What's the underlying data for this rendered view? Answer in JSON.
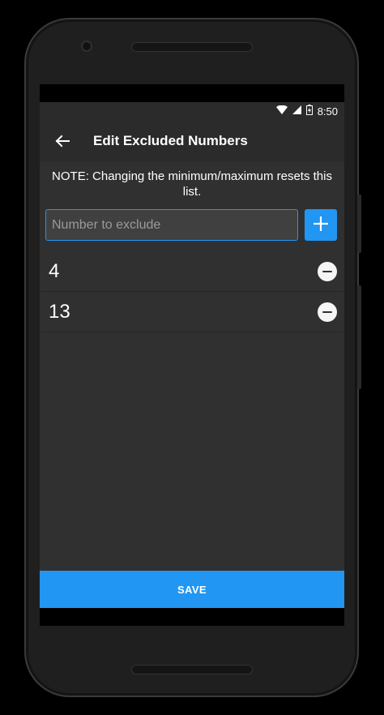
{
  "status_bar": {
    "time": "8:50",
    "icons": [
      "wifi-icon",
      "signal-icon",
      "battery-icon"
    ]
  },
  "app_bar": {
    "back_icon": "arrow-left-icon",
    "title": "Edit Excluded Numbers"
  },
  "note": "NOTE: Changing the minimum/maximum resets this list.",
  "exclude_input": {
    "value": "",
    "placeholder": "Number to exclude"
  },
  "add_button": {
    "icon": "plus-icon"
  },
  "excluded_numbers": [
    {
      "value": "4",
      "icon": "minus-circle-icon"
    },
    {
      "value": "13",
      "icon": "minus-circle-icon"
    }
  ],
  "save_button": {
    "label": "SAVE"
  },
  "colors": {
    "accent": "#2196F3",
    "bar": "#2b2b2b",
    "background": "#303030",
    "input": "#404040"
  }
}
